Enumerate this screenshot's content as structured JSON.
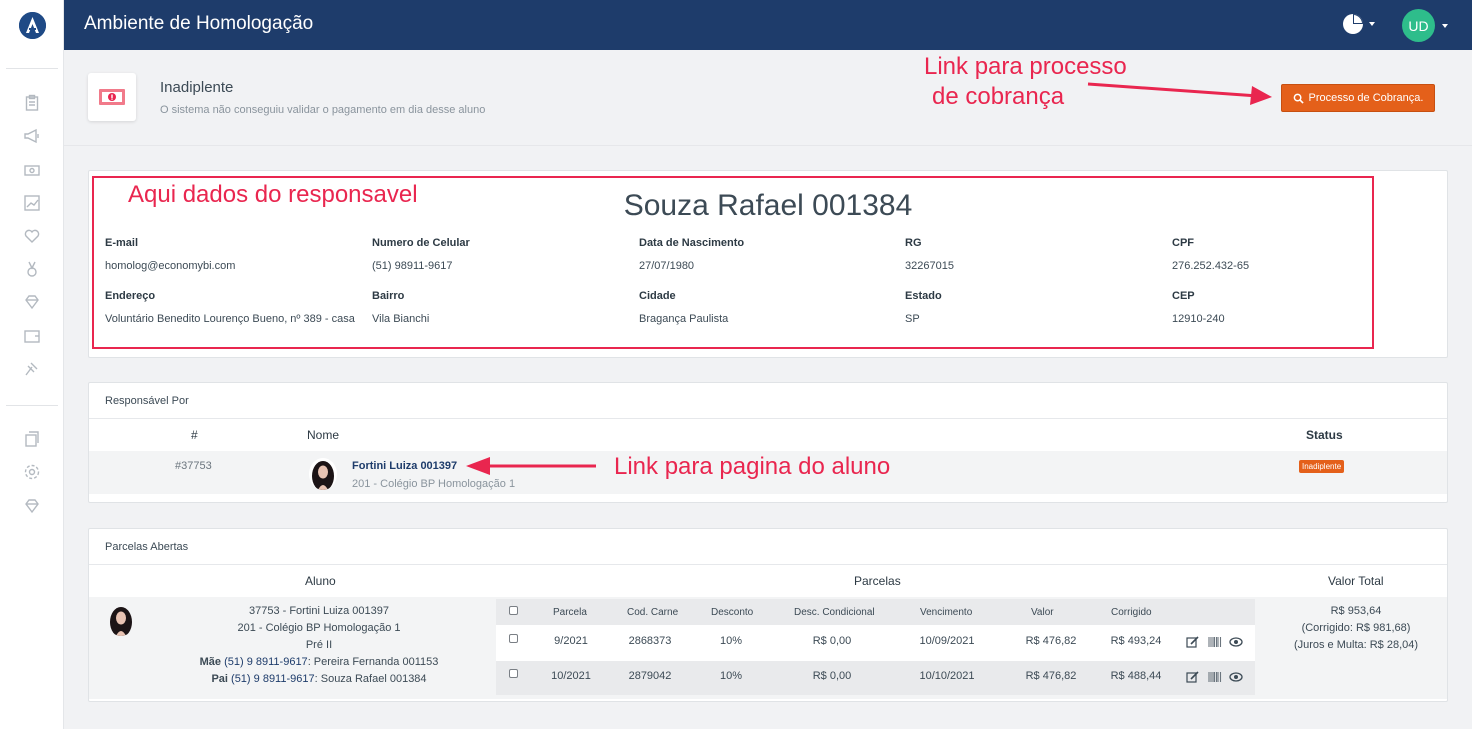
{
  "topbar": {
    "title": "Ambiente de Homologação",
    "user_initials": "UD"
  },
  "header": {
    "status_title": "Inadiplente",
    "status_subtitle": "O sistema não conseguiu validar o pagamento em dia desse aluno",
    "button_label": "Processo de Cobrança."
  },
  "annotations": {
    "cobranca_line1": "Link para processo",
    "cobranca_line2": "de cobrança",
    "responsavel": "Aqui  dados do responsavel",
    "aluno": "Link para pagina do aluno"
  },
  "responsavel": {
    "name": "Souza Rafael 001384",
    "fields": [
      {
        "label": "E-mail",
        "value": "homolog@economybi.com"
      },
      {
        "label": "Numero de Celular",
        "value": "(51) 98911-9617"
      },
      {
        "label": "Data de Nascimento",
        "value": "27/07/1980"
      },
      {
        "label": "RG",
        "value": "32267015"
      },
      {
        "label": "CPF",
        "value": "276.252.432-65"
      },
      {
        "label": "Endereço",
        "value": "Voluntário Benedito Lourenço Bueno, nº 389 - casa"
      },
      {
        "label": "Bairro",
        "value": "Vila Bianchi"
      },
      {
        "label": "Cidade",
        "value": "Bragança Paulista"
      },
      {
        "label": "Estado",
        "value": "SP"
      },
      {
        "label": "CEP",
        "value": "12910-240"
      }
    ]
  },
  "responsavel_por": {
    "title": "Responsável Por",
    "headers": {
      "id": "#",
      "name": "Nome",
      "status": "Status"
    },
    "row": {
      "id": "#37753",
      "name": "Fortini Luiza 001397",
      "class": "201 - Colégio BP Homologação 1",
      "status": "Inadiplente"
    }
  },
  "parcelas": {
    "title": "Parcelas Abertas",
    "headers": {
      "aluno": "Aluno",
      "parcelas": "Parcelas",
      "valor_total": "Valor Total"
    },
    "aluno": {
      "line1": "37753 - Fortini Luiza 001397",
      "line2": "201 - Colégio BP Homologação 1",
      "line3": "Pré II",
      "mae_label": "Mãe",
      "mae_phone": "(51) 9 8911-9617",
      "mae_name": ": Pereira Fernanda 001153",
      "pai_label": "Pai",
      "pai_phone": "(51) 9 8911-9617",
      "pai_name": ": Souza Rafael 001384"
    },
    "columns": [
      "Parcela",
      "Cod. Carne",
      "Desconto",
      "Desc. Condicional",
      "Vencimento",
      "Valor",
      "Corrigido"
    ],
    "rows": [
      {
        "parcela": "9/2021",
        "cod": "2868373",
        "desconto": "10%",
        "desc_cond": "R$ 0,00",
        "vencimento": "10/09/2021",
        "valor": "R$ 476,82",
        "corrigido": "R$ 493,24"
      },
      {
        "parcela": "10/2021",
        "cod": "2879042",
        "desconto": "10%",
        "desc_cond": "R$ 0,00",
        "vencimento": "10/10/2021",
        "valor": "R$ 476,82",
        "corrigido": "R$ 488,44"
      }
    ],
    "total": {
      "valor": "R$ 953,64",
      "corrigido": "(Corrigido: R$ 981,68)",
      "juros": "(Juros e Multa: R$ 28,04)"
    }
  },
  "colors": {
    "navy": "#1e3c6b",
    "orange": "#e4601a",
    "annotation": "#e9264f",
    "avatar": "#2ebd8b"
  }
}
